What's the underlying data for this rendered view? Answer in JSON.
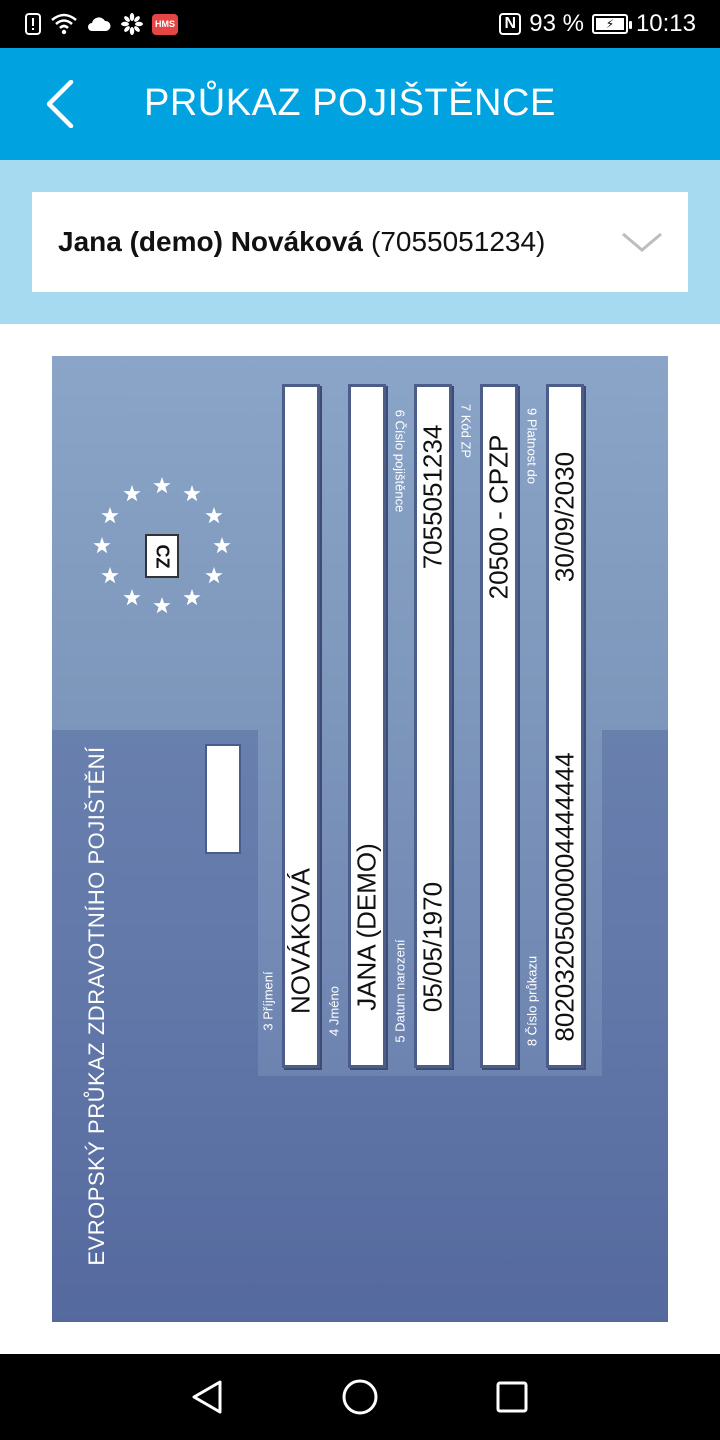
{
  "status_bar": {
    "hms": "HMS",
    "battery": "93 %",
    "time": "10:13",
    "nfc": "N",
    "icons": [
      "alert-icon",
      "wifi-icon",
      "cloud-icon",
      "huawei-icon",
      "hms-icon",
      "nfc-icon",
      "battery-charging-icon"
    ]
  },
  "app_bar": {
    "title": "PRŮKAZ POJIŠTĚNCE"
  },
  "selector": {
    "name": "Jana (demo) Nováková",
    "id": "(7055051234)"
  },
  "card": {
    "country": "CZ",
    "title": "EVROPSKÝ PRŮKAZ ZDRAVOTNÍHO POJIŠTĚNÍ",
    "fields": {
      "surname_label": "3 Příjmení",
      "surname": "NOVÁKOVÁ",
      "name_label": "4 Jméno",
      "name": "JANA (DEMO)",
      "birth_label": "5 Datum narození",
      "birth": "05/05/1970",
      "insured_no_label": "6 Číslo pojištěnce",
      "insured_no": "7055051234",
      "insurer_code_label": "7 Kód ZP",
      "insurer_code": "20500 - CPZP",
      "card_no_label": "8 Číslo průkazu",
      "card_no": "80203205000004444444",
      "valid_label": "9 Platnost do",
      "valid": "30/09/2030"
    }
  },
  "nav_bar": {
    "icons": [
      "back-triangle-icon",
      "home-circle-icon",
      "recents-square-icon"
    ]
  }
}
